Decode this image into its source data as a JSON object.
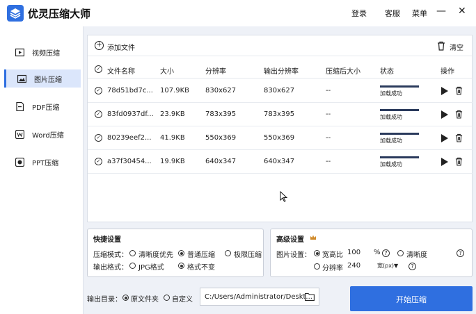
{
  "app": {
    "title": "优灵压缩大师",
    "login": "登录",
    "service": "客服",
    "menu": "菜单",
    "minimize": "—",
    "close": "✕"
  },
  "sidebar": {
    "items": [
      {
        "label": "视频压缩",
        "icon": "video-icon"
      },
      {
        "label": "图片压缩",
        "icon": "image-icon",
        "active": true
      },
      {
        "label": "PDF压缩",
        "icon": "pdf-icon"
      },
      {
        "label": "Word压缩",
        "icon": "word-icon"
      },
      {
        "label": "PPT压缩",
        "icon": "ppt-icon"
      }
    ]
  },
  "toolbar": {
    "add_label": "添加文件",
    "clear_label": "清空"
  },
  "table": {
    "headers": [
      "文件名称",
      "大小",
      "分辨率",
      "输出分辨率",
      "压缩后大小",
      "状态",
      "操作"
    ],
    "rows": [
      {
        "name": "78d51bd7c...",
        "size": "107.9KB",
        "res": "830x627",
        "out_res": "830x627",
        "after": "--",
        "status": "加载成功"
      },
      {
        "name": "83fd0937df...",
        "size": "23.9KB",
        "res": "783x395",
        "out_res": "783x395",
        "after": "--",
        "status": "加载成功"
      },
      {
        "name": "80239eef2...",
        "size": "41.9KB",
        "res": "550x369",
        "out_res": "550x369",
        "after": "--",
        "status": "加载成功"
      },
      {
        "name": "a37f30454...",
        "size": "19.9KB",
        "res": "640x347",
        "out_res": "640x347",
        "after": "--",
        "status": "加载成功"
      }
    ]
  },
  "quick": {
    "title": "快捷设置",
    "mode_label": "压缩模式：",
    "modes": [
      "清晰度优先",
      "普通压缩",
      "极限压缩"
    ],
    "format_label": "输出格式：",
    "formats": [
      "JPG格式",
      "格式不变"
    ]
  },
  "advanced": {
    "title": "高级设置",
    "img_label": "图片设置：",
    "ratio_label": "宽高比",
    "ratio_value": "100",
    "ratio_unit": "%",
    "clarity_label": "清晰度",
    "res_label": "分辨率",
    "res_value": "240",
    "res_unit": "宽(px)▼"
  },
  "output": {
    "label": "输出目录：",
    "opt_original": "原文件夹",
    "opt_custom": "自定义",
    "path": "C:/Users/Administrator/Deskt...",
    "start": "开始压缩"
  },
  "colors": {
    "accent": "#2f6fe0",
    "status_bar": "#2a3a5c"
  }
}
